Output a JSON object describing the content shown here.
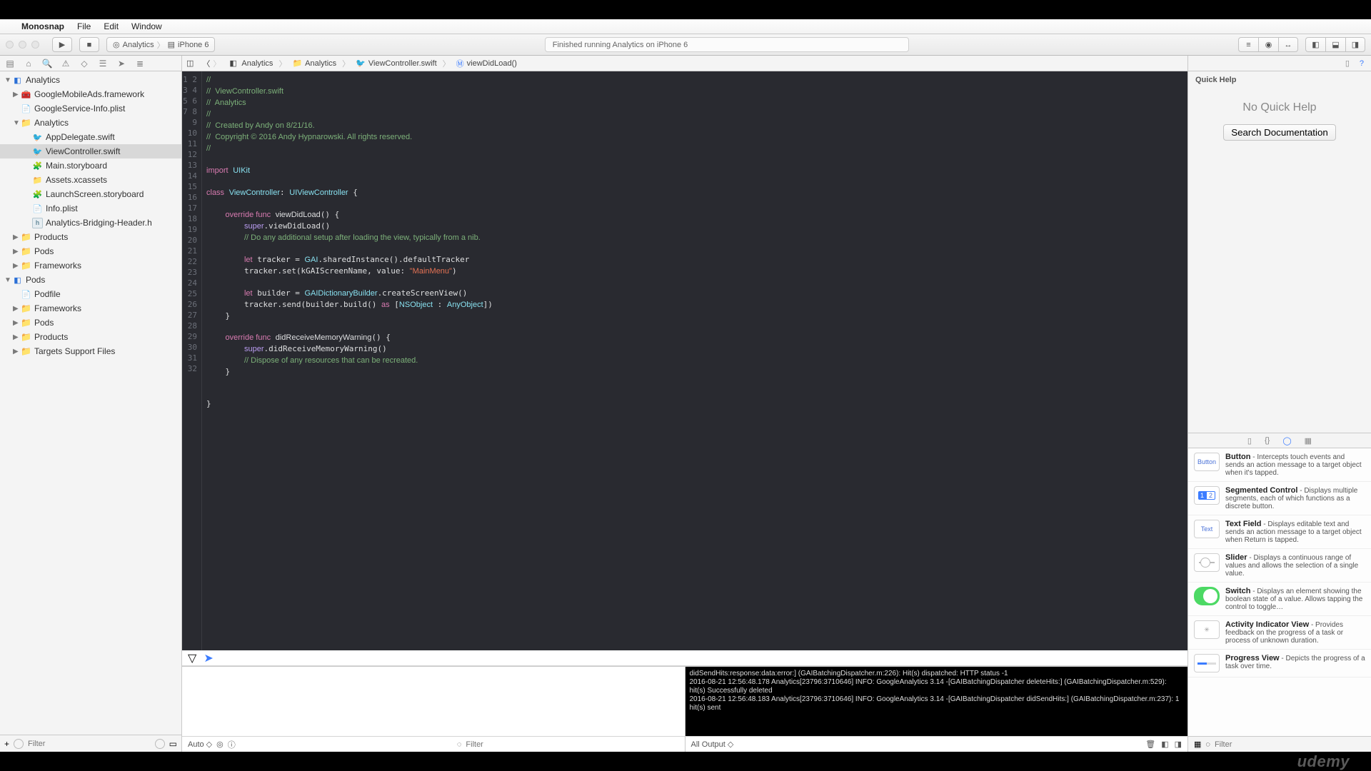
{
  "menubar": {
    "apple": "",
    "app": "Monosnap",
    "items": [
      "File",
      "Edit",
      "Window"
    ]
  },
  "toolbar": {
    "scheme_project": "Analytics",
    "scheme_device": "iPhone 6",
    "status": "Finished running Analytics on iPhone 6"
  },
  "sidebar": {
    "tree": [
      {
        "depth": 0,
        "kind": "proj",
        "name": "Analytics",
        "tw": "▼"
      },
      {
        "depth": 1,
        "kind": "fw",
        "name": "GoogleMobileAds.framework",
        "tw": "▶"
      },
      {
        "depth": 1,
        "kind": "plist",
        "name": "GoogleService-Info.plist",
        "tw": ""
      },
      {
        "depth": 1,
        "kind": "fold",
        "name": "Analytics",
        "tw": "▼"
      },
      {
        "depth": 2,
        "kind": "swift",
        "name": "AppDelegate.swift",
        "tw": ""
      },
      {
        "depth": 2,
        "kind": "swift",
        "name": "ViewController.swift",
        "tw": "",
        "sel": true
      },
      {
        "depth": 2,
        "kind": "sb",
        "name": "Main.storyboard",
        "tw": ""
      },
      {
        "depth": 2,
        "kind": "assets",
        "name": "Assets.xcassets",
        "tw": ""
      },
      {
        "depth": 2,
        "kind": "sb",
        "name": "LaunchScreen.storyboard",
        "tw": ""
      },
      {
        "depth": 2,
        "kind": "plist",
        "name": "Info.plist",
        "tw": ""
      },
      {
        "depth": 2,
        "kind": "h",
        "name": "Analytics-Bridging-Header.h",
        "tw": ""
      },
      {
        "depth": 1,
        "kind": "fold",
        "name": "Products",
        "tw": "▶"
      },
      {
        "depth": 1,
        "kind": "fold",
        "name": "Pods",
        "tw": "▶"
      },
      {
        "depth": 1,
        "kind": "fold",
        "name": "Frameworks",
        "tw": "▶"
      },
      {
        "depth": 0,
        "kind": "proj",
        "name": "Pods",
        "tw": "▼"
      },
      {
        "depth": 1,
        "kind": "plist",
        "name": "Podfile",
        "tw": ""
      },
      {
        "depth": 1,
        "kind": "fold",
        "name": "Frameworks",
        "tw": "▶"
      },
      {
        "depth": 1,
        "kind": "fold",
        "name": "Pods",
        "tw": "▶"
      },
      {
        "depth": 1,
        "kind": "fold",
        "name": "Products",
        "tw": "▶"
      },
      {
        "depth": 1,
        "kind": "fold",
        "name": "Targets Support Files",
        "tw": "▶"
      }
    ],
    "filter_placeholder": "Filter"
  },
  "jumpbar": [
    "Analytics",
    "Analytics",
    "ViewController.swift",
    "viewDidLoad()"
  ],
  "code_lines": 32,
  "vars_foot": {
    "label": "Auto ◇",
    "filter": "Filter"
  },
  "console": {
    "lines": [
      "didSendHits:response:data:error:] (GAIBatchingDispatcher.m:226): Hit(s) dispatched: HTTP status -1",
      "2016-08-21 12:56:48.178 Analytics[23796:3710646] INFO: GoogleAnalytics 3.14 -[GAIBatchingDispatcher deleteHits:] (GAIBatchingDispatcher.m:529): hit(s) Successfully deleted",
      "2016-08-21 12:56:48.183 Analytics[23796:3710646] INFO: GoogleAnalytics 3.14 -[GAIBatchingDispatcher didSendHits:] (GAIBatchingDispatcher.m:237): 1 hit(s) sent"
    ],
    "footer": "All Output ◇",
    "filter": "Filter"
  },
  "quickhelp": {
    "title": "Quick Help",
    "none": "No Quick Help",
    "btn": "Search Documentation"
  },
  "library": [
    {
      "icon": "button",
      "title": "Button",
      "desc": "Intercepts touch events and sends an action message to a target object when it's tapped."
    },
    {
      "icon": "seg",
      "title": "Segmented Control",
      "desc": "Displays multiple segments, each of which functions as a discrete button."
    },
    {
      "icon": "text",
      "title": "Text Field",
      "desc": "Displays editable text and sends an action message to a target object when Return is tapped."
    },
    {
      "icon": "slider",
      "title": "Slider",
      "desc": "Displays a continuous range of values and allows the selection of a single value."
    },
    {
      "icon": "switch",
      "title": "Switch",
      "desc": "Displays an element showing the boolean state of a value. Allows tapping the control to toggle…"
    },
    {
      "icon": "spinner",
      "title": "Activity Indicator View",
      "desc": "Provides feedback on the progress of a task or process of unknown duration."
    },
    {
      "icon": "progress",
      "title": "Progress View",
      "desc": "Depicts the progress of a task over time."
    }
  ],
  "watermark": "udemy"
}
